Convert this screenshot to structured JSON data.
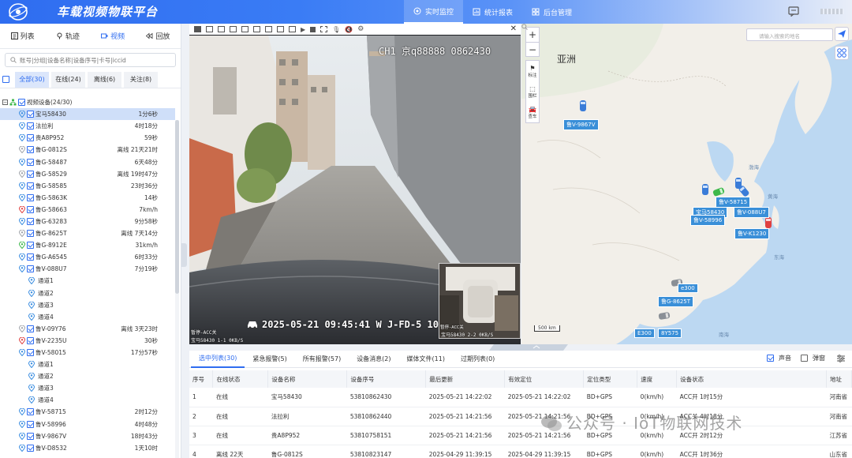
{
  "app": {
    "title": "车载视频物联平台"
  },
  "header": {
    "nav": [
      {
        "label": "实时监控",
        "icon": "location-icon",
        "active": true
      },
      {
        "label": "统计报表",
        "icon": "report-icon",
        "active": false
      },
      {
        "label": "后台管理",
        "icon": "grid-icon",
        "active": false
      }
    ]
  },
  "left": {
    "tabs": [
      {
        "label": "列表",
        "icon": "list-icon"
      },
      {
        "label": "轨迹",
        "icon": "track-icon"
      },
      {
        "label": "视频",
        "icon": "video-icon",
        "active": true
      },
      {
        "label": "回放",
        "icon": "playback-icon"
      }
    ],
    "search_placeholder": "账号|分组|设备名称|设备序号|卡号|iccid",
    "filters": [
      {
        "label": "全部(30)",
        "active": true
      },
      {
        "label": "在线(24)"
      },
      {
        "label": "离线(6)"
      },
      {
        "label": "关注(8)"
      }
    ],
    "root_label": "视频设备(24/30)",
    "devices": [
      {
        "name": "宝马58430",
        "status": "1分6秒",
        "pin": "blue",
        "selected": true
      },
      {
        "name": "法拉利",
        "status": "4时18分",
        "pin": "blue"
      },
      {
        "name": "贵A8P952",
        "status": "59秒",
        "pin": "blue"
      },
      {
        "name": "鲁G-0812S",
        "status": "离线 21天21时",
        "pin": "gray"
      },
      {
        "name": "鲁G-58487",
        "status": "6天48分",
        "pin": "blue"
      },
      {
        "name": "鲁G-58529",
        "status": "离线 19时47分",
        "pin": "gray"
      },
      {
        "name": "鲁G-58585",
        "status": "23时36分",
        "pin": "blue"
      },
      {
        "name": "鲁G-5863K",
        "status": "14秒",
        "pin": "blue"
      },
      {
        "name": "鲁G-58663",
        "status": "7km/h",
        "pin": "red"
      },
      {
        "name": "鲁G-63283",
        "status": "9分58秒",
        "pin": "blue"
      },
      {
        "name": "鲁G-8625T",
        "status": "离线 7天14分",
        "pin": "gray"
      },
      {
        "name": "鲁G-8912E",
        "status": "31km/h",
        "pin": "green"
      },
      {
        "name": "鲁G-A6545",
        "status": "6时33分",
        "pin": "blue"
      },
      {
        "name": "鲁V-088U7",
        "status": "7分19秒",
        "pin": "blue",
        "expanded": true
      },
      {
        "name": "通道1",
        "channel": true
      },
      {
        "name": "通道2",
        "channel": true
      },
      {
        "name": "通道3",
        "channel": true
      },
      {
        "name": "通道4",
        "channel": true
      },
      {
        "name": "鲁V-09Y76",
        "status": "离线 3天23时",
        "pin": "gray"
      },
      {
        "name": "鲁V-2235U",
        "status": "30秒",
        "pin": "red"
      },
      {
        "name": "鲁V-58015",
        "status": "17分57秒",
        "pin": "blue",
        "expanded": true
      },
      {
        "name": "通道1",
        "channel": true
      },
      {
        "name": "通道2",
        "channel": true
      },
      {
        "name": "通道3",
        "channel": true
      },
      {
        "name": "通道4",
        "channel": true
      },
      {
        "name": "鲁V-58715",
        "status": "2时12分",
        "pin": "blue"
      },
      {
        "name": "鲁V-58996",
        "status": "4时48分",
        "pin": "blue"
      },
      {
        "name": "鲁V-9867V",
        "status": "18时43分",
        "pin": "blue"
      },
      {
        "name": "鲁V-D8532",
        "status": "1天10时",
        "pin": "blue"
      }
    ]
  },
  "video": {
    "osd_top": "CH1 京q88888 0862430",
    "osd_time": "2025-05-21  09:45:41 W J-FD-5  10",
    "osd_status": "暂停-ACC关",
    "osd_bottom": "宝马58430    1-1    0KB/S",
    "pip_status": "暂停-ACC关",
    "pip_bottom": "宝马58430   2-2   0KB/S"
  },
  "map": {
    "search_placeholder": "请输入搜索的地名",
    "continent": "亚洲",
    "tools": [
      "标注",
      "围栏",
      "查车"
    ],
    "seas": [
      "渤海",
      "黄海",
      "东海",
      "南海"
    ],
    "scale": "500 km",
    "labels": [
      "鲁V-9867V",
      "鲁V-58715",
      "宝马58430",
      "鲁V-088U7",
      "鲁V-58996",
      "鲁V-K1230",
      "e300",
      "鲁G-8625T",
      "E300",
      "8Y575"
    ]
  },
  "bottom": {
    "tabs": [
      {
        "label": "选中列表(30)",
        "active": true
      },
      {
        "label": "紧急报警(5)"
      },
      {
        "label": "所有报警(57)"
      },
      {
        "label": "设备消息(2)"
      },
      {
        "label": "媒体文件(11)"
      },
      {
        "label": "过期列表(0)"
      }
    ],
    "options": {
      "sound": "声音",
      "popup": "弹窗"
    },
    "columns": [
      "序号",
      "在线状态",
      "设备名称",
      "设备序号",
      "最后更新",
      "有效定位",
      "定位类型",
      "速度",
      "设备状态",
      "地址"
    ],
    "rows": [
      [
        "1",
        "在线",
        "宝马58430",
        "53810862430",
        "2025-05-21 14:22:02",
        "2025-05-21 14:22:02",
        "BD+GPS",
        "0(km/h)",
        "ACC开 1时15分",
        "河南省"
      ],
      [
        "2",
        "在线",
        "法拉利",
        "53810862440",
        "2025-05-21 14:21:56",
        "2025-05-21 14:21:56",
        "BD+GPS",
        "0(km/h)",
        "ACC关 4时18分",
        "河南省"
      ],
      [
        "3",
        "在线",
        "贵A8P952",
        "53810758151",
        "2025-05-21 14:21:56",
        "2025-05-21 14:21:56",
        "BD+GPS",
        "0(km/h)",
        "ACC开 2时12分",
        "江苏省"
      ],
      [
        "4",
        "离线 22天",
        "鲁G-0812S",
        "53810823147",
        "2025-04-29 11:39:15",
        "2025-04-29 11:39:15",
        "BD+GPS",
        "0(km/h)",
        "ACC开 1时36分",
        "山东省"
      ]
    ]
  },
  "watermark": "公众号 · IoT物联网技术",
  "colors": {
    "accent": "#2f6df0",
    "online": "#2f6df0",
    "offline": "#9a9a9a",
    "alarm": "#e04040",
    "moving": "#3db84a"
  }
}
